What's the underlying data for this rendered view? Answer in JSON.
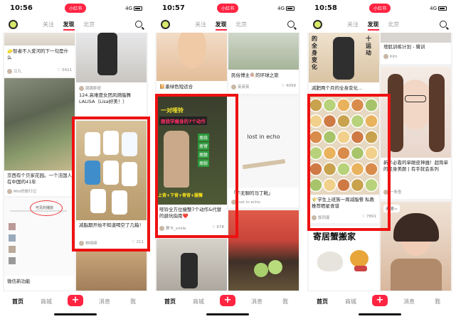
{
  "phones": [
    {
      "time": "10:56",
      "signal": "4G",
      "pill": "小红书",
      "tabs": {
        "follow": "关注",
        "discover": "发现",
        "local": "北京"
      },
      "bottom": {
        "home": "首页",
        "shop": "商城",
        "plus": "+",
        "messages": "消息",
        "me": "我"
      },
      "cards": [
        {
          "title": "🧽智者不入爱河的下一句是什么",
          "author": "江九",
          "likes": "5421"
        },
        {
          "title": "",
          "author": "",
          "likes": ""
        },
        {
          "title": "124.高难度女团风燃脂舞 LALISA（Lisa好美！）",
          "author": "跳跳胖妞",
          "likes": ""
        },
        {
          "title": "京西有个贝家花园。一个法国人在中国的41年",
          "author": "Mm的旅行记",
          "likes": ""
        },
        {
          "title": "减脂期开始不知道喝空了几箱！",
          "author": "林绵绵",
          "likes": "211"
        },
        {
          "title": "微信新功能",
          "author": "",
          "likes": "",
          "bubble": "可见的播放"
        }
      ]
    },
    {
      "time": "10:57",
      "signal": "4G",
      "pill": "小红书",
      "tabs": {
        "follow": "关注",
        "discover": "发现",
        "local": "北京"
      },
      "bottom": {
        "home": "首页",
        "shop": "商城",
        "plus": "+",
        "messages": "消息",
        "me": "我"
      },
      "cards": [
        {
          "title": "📔墨绿色短适合",
          "author": "",
          "likes": ""
        },
        {
          "title": "民俗博主🍭的环球之旅",
          "author": "英英英",
          "likes": "4099"
        },
        {
          "title": "哑铃全方位瘦整7个动作&代替的避坑指南❤️",
          "author": "赛卡_smile",
          "likes": "678",
          "overlay_title": "一对哑铃",
          "overlay_sub": "跟我学瘦身的7个动作",
          "overlay_tags": [
            "瘦肩",
            "瘦臂",
            "瘦腰",
            "瘦腿"
          ],
          "overlay_bottom": "上背+下背+脊背+腿臀"
        },
        {
          "title": "「不无聊的马丁靴」",
          "author": "lost in echo",
          "likes": "",
          "center_text": "lost in echo"
        }
      ]
    },
    {
      "time": "10:58",
      "signal": "4G",
      "pill": "小红书",
      "tabs": {
        "follow": "关注",
        "discover": "发现",
        "local": "北京"
      },
      "bottom": {
        "home": "首页",
        "shop": "商城",
        "plus": "+",
        "messages": "消息",
        "me": "我"
      },
      "cards": [
        {
          "title": "减肥两个月的全身变化...",
          "author": "",
          "likes": "",
          "big_text": "的全身变化",
          "big_text2": "十运动"
        },
        {
          "title": "增肌训练计划 - 臀训",
          "author": "Kim",
          "likes": ""
        },
        {
          "title": "🌾学生上班族一周减脂餐 私教推荐晒星食谱",
          "author": "饭同曼",
          "likes": "7891"
        },
        {
          "title": "新手必看的单眼皮神器！超简单的变身美颜 | 有手就会系列",
          "author": "一条鱼",
          "likes": ""
        },
        {
          "title": "寄居蟹搬家",
          "author": "",
          "likes": ""
        },
        {
          "title": "天凉~",
          "author": "",
          "likes": ""
        }
      ]
    }
  ]
}
